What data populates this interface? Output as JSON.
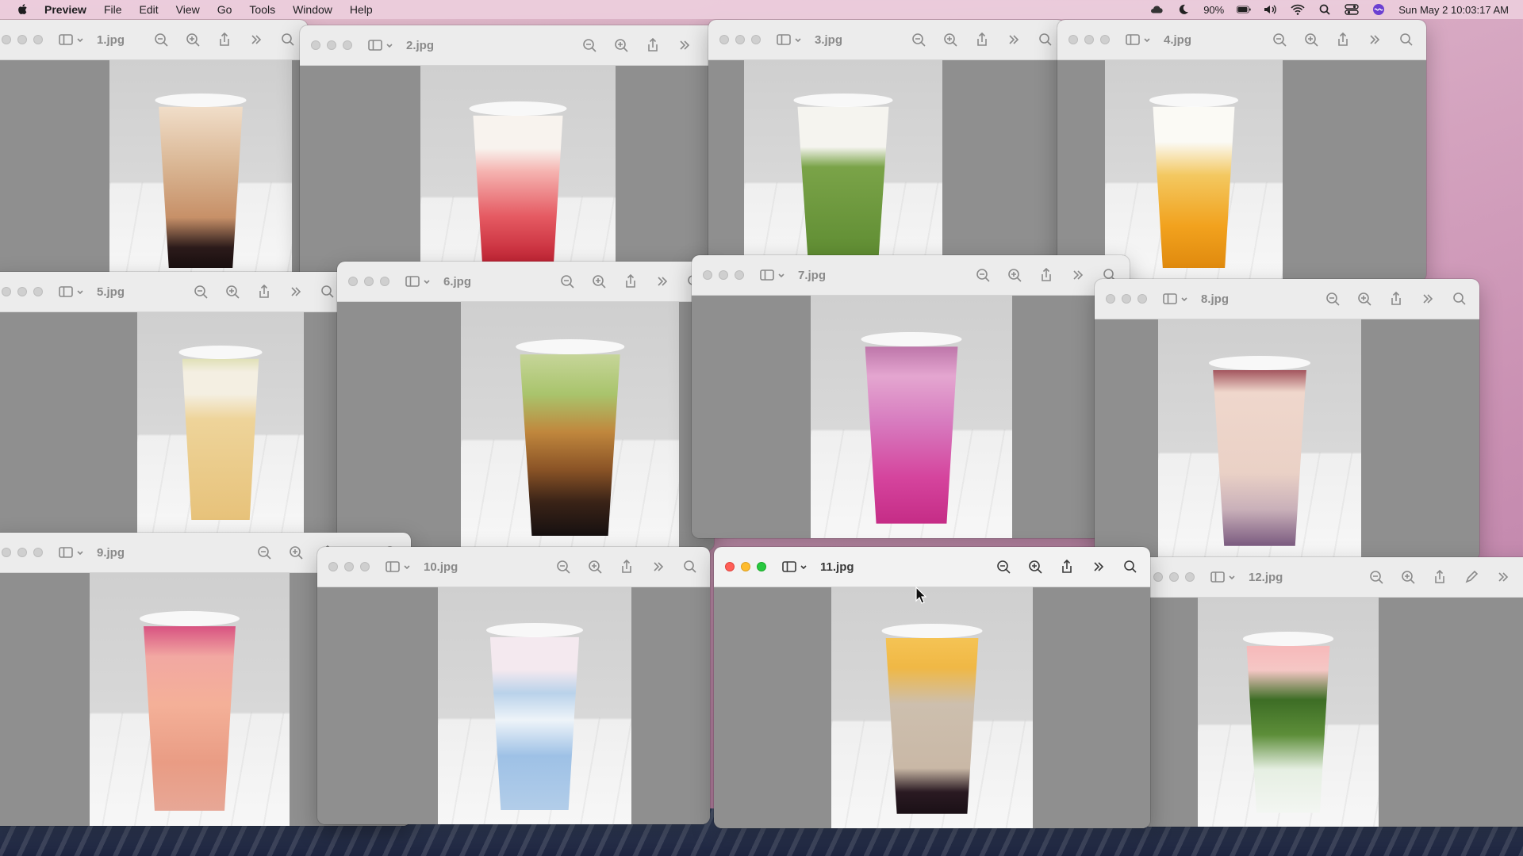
{
  "menubar": {
    "app_name": "Preview",
    "items": [
      "File",
      "Edit",
      "View",
      "Go",
      "Tools",
      "Window",
      "Help"
    ],
    "battery": "90%",
    "datetime": "Sun May 2  10:03:17 AM"
  },
  "windows": [
    {
      "title": "1.jpg",
      "active": false,
      "drink": "brown sugar boba milk tea"
    },
    {
      "title": "2.jpg",
      "active": false,
      "drink": "strawberry cheese foam"
    },
    {
      "title": "3.jpg",
      "active": false,
      "drink": "matcha latte"
    },
    {
      "title": "4.jpg",
      "active": false,
      "drink": "mango cream"
    },
    {
      "title": "5.jpg",
      "active": false,
      "drink": "matcha foam tea"
    },
    {
      "title": "6.jpg",
      "active": false,
      "drink": "matcha brown sugar"
    },
    {
      "title": "7.jpg",
      "active": false,
      "drink": "dragon fruit smoothie"
    },
    {
      "title": "8.jpg",
      "active": false,
      "drink": "red bean milk tea"
    },
    {
      "title": "9.jpg",
      "active": false,
      "drink": "passion fruit pitaya"
    },
    {
      "title": "10.jpg",
      "active": false,
      "drink": "blue butterfly pea cream"
    },
    {
      "title": "11.jpg",
      "active": true,
      "drink": "mango jelly milk tea"
    },
    {
      "title": "12.jpg",
      "active": false,
      "drink": "matcha strawberry cream"
    }
  ],
  "colors": {
    "active_close": "#ff5f57",
    "active_min": "#febc2e",
    "active_max": "#28c840",
    "desktop": "#d7a8c2"
  }
}
